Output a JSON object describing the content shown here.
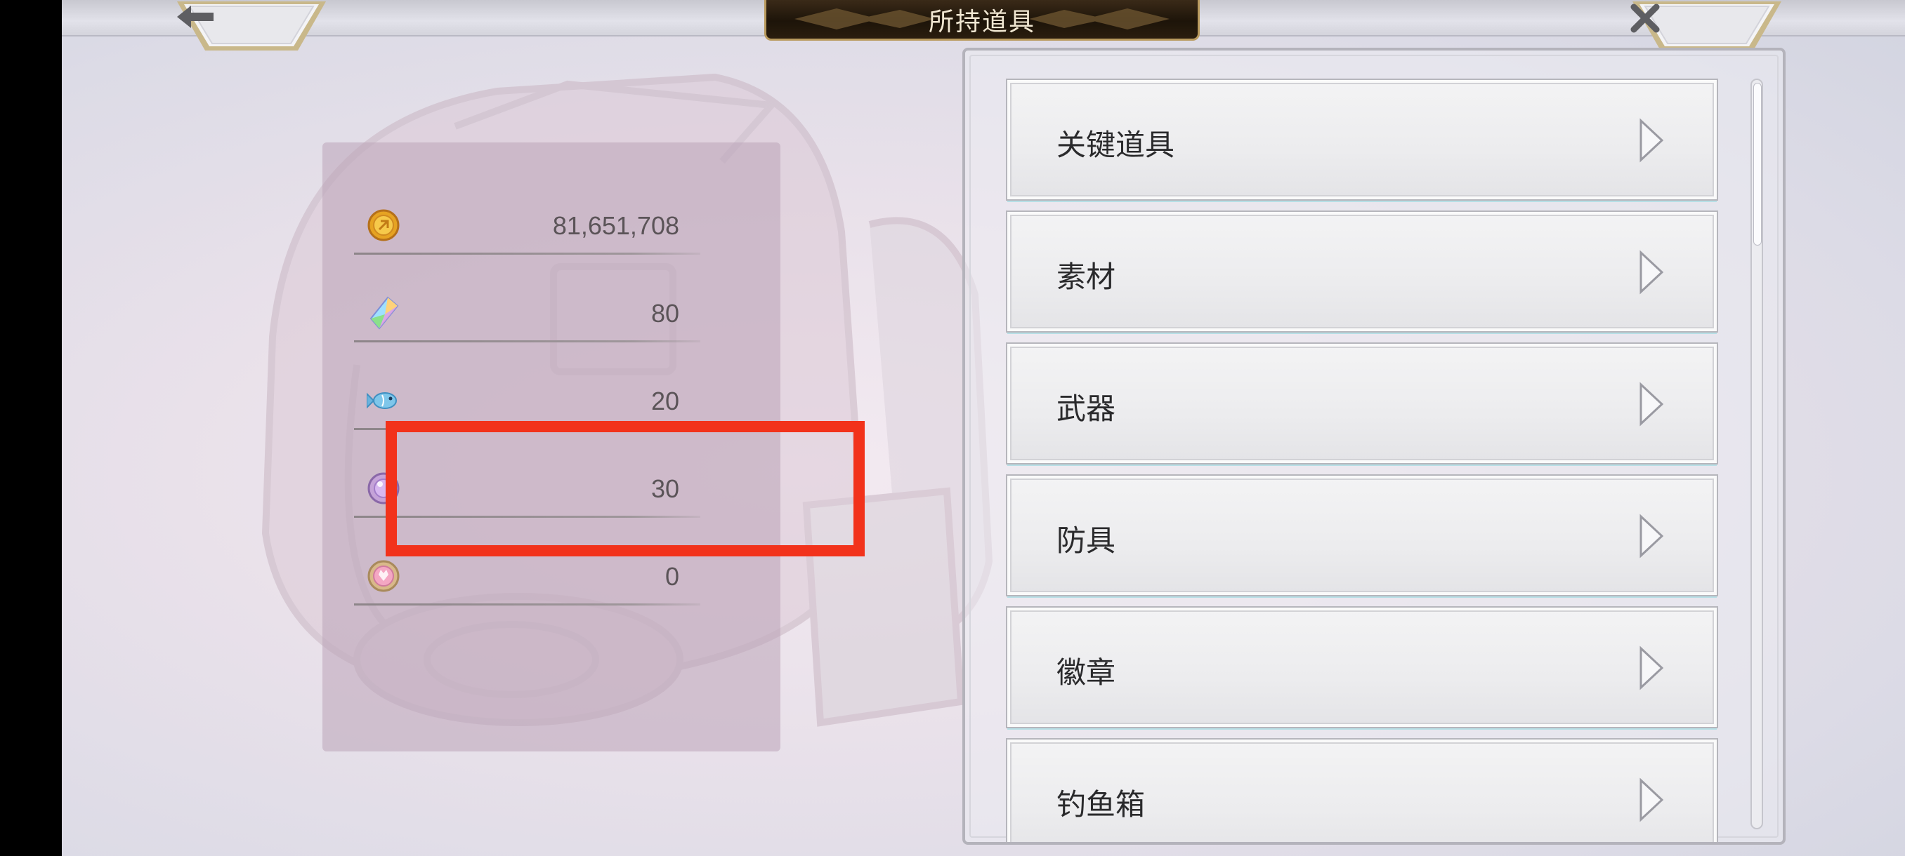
{
  "header": {
    "title": "所持道具",
    "back_icon": "arrow-left-icon",
    "close_icon": "close-icon"
  },
  "currencies": [
    {
      "icon": "gold-coin-icon",
      "value": "81,651,708"
    },
    {
      "icon": "rainbow-crystal-icon",
      "value": "80"
    },
    {
      "icon": "fish-icon",
      "value": "20"
    },
    {
      "icon": "purple-orb-icon",
      "value": "30",
      "highlighted": true
    },
    {
      "icon": "pink-medal-icon",
      "value": "0"
    }
  ],
  "categories": [
    {
      "label": "关键道具"
    },
    {
      "label": "素材"
    },
    {
      "label": "武器"
    },
    {
      "label": "防具"
    },
    {
      "label": "徽章"
    },
    {
      "label": "钓鱼箱"
    }
  ],
  "colors": {
    "highlight": "#f2321b",
    "banner": "#1d1409",
    "banner_border": "#b99a5e"
  }
}
